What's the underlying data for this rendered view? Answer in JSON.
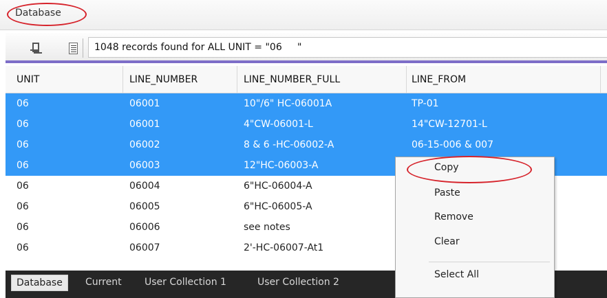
{
  "window": {
    "title": "Database"
  },
  "toolbar": {
    "pin_icon": "pin-icon",
    "list_icon": "list-icon",
    "records_text": "1048 records found for ALL UNIT = \"06     \""
  },
  "table": {
    "columns": [
      "UNIT",
      "LINE_NUMBER",
      "LINE_NUMBER_FULL",
      "LINE_FROM"
    ],
    "rows": [
      {
        "unit": "06",
        "line_number": "06001",
        "line_number_full": "10\"/6\" HC-06001A",
        "line_from": "TP-01",
        "selected": true
      },
      {
        "unit": "06",
        "line_number": "06001",
        "line_number_full": "4\"CW-06001-L",
        "line_from": "14\"CW-12701-L",
        "selected": true
      },
      {
        "unit": "06",
        "line_number": "06002",
        "line_number_full": "8 & 6 -HC-06002-A",
        "line_from": "06-15-006 & 007",
        "selected": true
      },
      {
        "unit": "06",
        "line_number": "06003",
        "line_number_full": "12\"HC-06003-A",
        "line_from": "",
        "selected": true
      },
      {
        "unit": "06",
        "line_number": "06004",
        "line_number_full": "6\"HC-06004-A",
        "line_from": "",
        "selected": false
      },
      {
        "unit": "06",
        "line_number": "06005",
        "line_number_full": "6\"HC-06005-A",
        "line_from": "",
        "selected": false
      },
      {
        "unit": "06",
        "line_number": "06006",
        "line_number_full": "see notes",
        "line_from": "",
        "selected": false
      },
      {
        "unit": "06",
        "line_number": "06007",
        "line_number_full": "2'-HC-06007-At1",
        "line_from": "",
        "selected": false
      }
    ],
    "selection_color": "#3399f7"
  },
  "tabs": [
    {
      "label": "Database",
      "active": true
    },
    {
      "label": "Current",
      "active": false
    },
    {
      "label": "User Collection 1",
      "active": false
    },
    {
      "label": "User Collection 2",
      "active": false
    }
  ],
  "context_menu": {
    "items": [
      "Copy",
      "Paste",
      "Remove",
      "Clear",
      "Select All"
    ]
  },
  "annotation_color": "#d6232b"
}
